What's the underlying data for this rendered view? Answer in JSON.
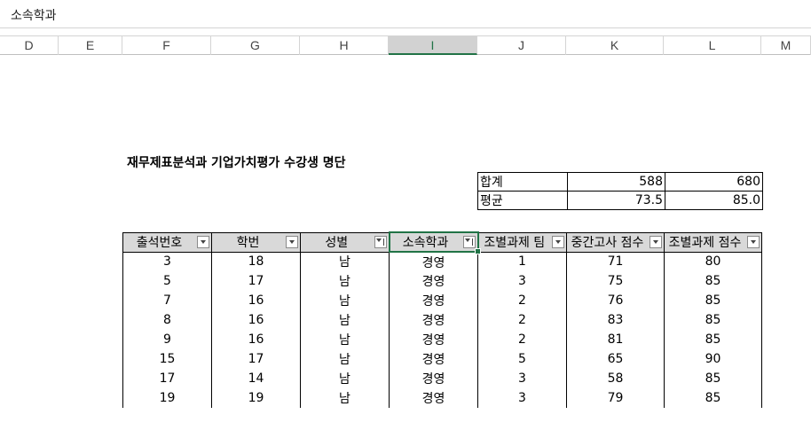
{
  "formula_bar": {
    "value": "소속학과"
  },
  "columns": [
    {
      "letter": "D",
      "selected": false
    },
    {
      "letter": "E",
      "selected": false
    },
    {
      "letter": "F",
      "selected": false
    },
    {
      "letter": "G",
      "selected": false
    },
    {
      "letter": "H",
      "selected": false
    },
    {
      "letter": "I",
      "selected": true
    },
    {
      "letter": "J",
      "selected": false
    },
    {
      "letter": "K",
      "selected": false
    },
    {
      "letter": "L",
      "selected": false
    },
    {
      "letter": "M",
      "selected": false
    }
  ],
  "sheet": {
    "title": "재무제표분석과 기업가치평가 수강생 명단",
    "summary": [
      {
        "label": "합계",
        "k": "588",
        "l": "680"
      },
      {
        "label": "평균",
        "k": "73.5",
        "l": "85.0"
      }
    ],
    "table": {
      "headers": [
        {
          "label": "출석번호",
          "filter_active": false
        },
        {
          "label": "학번",
          "filter_active": false
        },
        {
          "label": "성별",
          "filter_active": true
        },
        {
          "label": "소속학과",
          "filter_active": true
        },
        {
          "label": "조별과제 팀",
          "filter_active": false
        },
        {
          "label": "중간고사 점수",
          "filter_active": false
        },
        {
          "label": "조별과제 점수",
          "filter_active": false
        }
      ],
      "rows": [
        [
          "3",
          "18",
          "남",
          "경영",
          "1",
          "71",
          "80"
        ],
        [
          "5",
          "17",
          "남",
          "경영",
          "3",
          "75",
          "85"
        ],
        [
          "7",
          "16",
          "남",
          "경영",
          "2",
          "76",
          "85"
        ],
        [
          "8",
          "16",
          "남",
          "경영",
          "2",
          "83",
          "85"
        ],
        [
          "9",
          "16",
          "남",
          "경영",
          "2",
          "81",
          "85"
        ],
        [
          "15",
          "17",
          "남",
          "경영",
          "5",
          "65",
          "90"
        ],
        [
          "17",
          "14",
          "남",
          "경영",
          "3",
          "58",
          "85"
        ],
        [
          "19",
          "19",
          "남",
          "경영",
          "3",
          "79",
          "85"
        ]
      ]
    }
  },
  "colors": {
    "accent": "#217346",
    "header_fill": "#d9d9d9"
  }
}
